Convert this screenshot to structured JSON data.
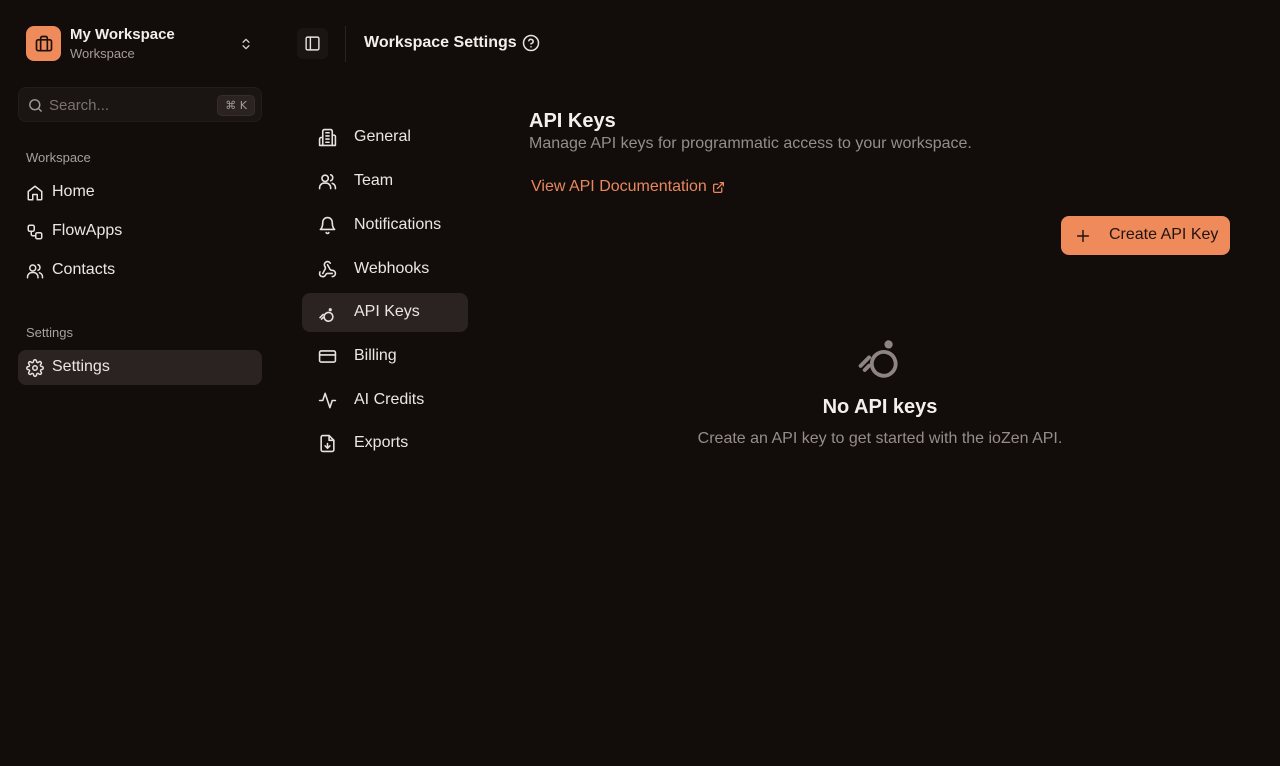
{
  "workspace": {
    "name": "My Workspace",
    "subtitle": "Workspace"
  },
  "search": {
    "placeholder": "Search...",
    "shortcut": "⌘ K"
  },
  "sidebar": {
    "groups": [
      {
        "label": "Workspace",
        "items": [
          {
            "label": "Home",
            "icon": "home-icon"
          },
          {
            "label": "FlowApps",
            "icon": "workflow-icon"
          },
          {
            "label": "Contacts",
            "icon": "users-icon"
          }
        ]
      },
      {
        "label": "Settings",
        "items": [
          {
            "label": "Settings",
            "icon": "gear-icon",
            "active": true
          }
        ]
      }
    ]
  },
  "header": {
    "title": "Workspace Settings"
  },
  "settings_menu": {
    "items": [
      {
        "label": "General",
        "icon": "building-icon"
      },
      {
        "label": "Team",
        "icon": "users-icon"
      },
      {
        "label": "Notifications",
        "icon": "bell-icon"
      },
      {
        "label": "Webhooks",
        "icon": "webhook-icon"
      },
      {
        "label": "API Keys",
        "icon": "key-icon",
        "active": true
      },
      {
        "label": "Billing",
        "icon": "credit-card-icon"
      },
      {
        "label": "AI Credits",
        "icon": "activity-icon"
      },
      {
        "label": "Exports",
        "icon": "file-download-icon"
      }
    ]
  },
  "content": {
    "title": "API Keys",
    "subtitle": "Manage API keys for programmatic access to your workspace.",
    "doc_link": "View API Documentation",
    "create_button": "Create API Key",
    "empty_title": "No API keys",
    "empty_subtitle": "Create an API key to get started with the ioZen API."
  },
  "colors": {
    "background": "#120c0b",
    "accent": "#ef8a5b",
    "link": "#e8885f",
    "active_bg": "#2a2321"
  }
}
